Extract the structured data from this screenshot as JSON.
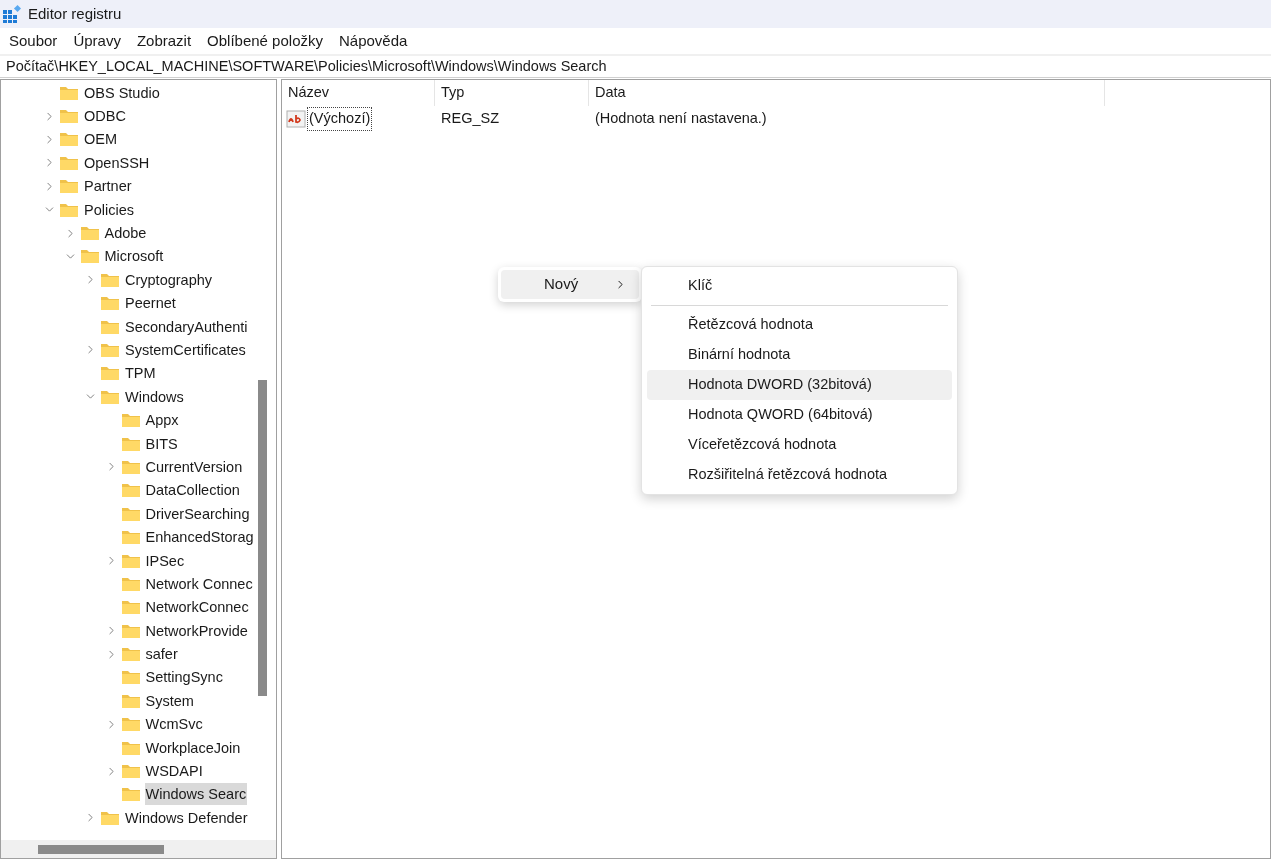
{
  "window": {
    "title": "Editor registru"
  },
  "menu": [
    "Soubor",
    "Úpravy",
    "Zobrazit",
    "Oblíbené položky",
    "Nápověda"
  ],
  "address": "Počítač\\HKEY_LOCAL_MACHINE\\SOFTWARE\\Policies\\Microsoft\\Windows\\Windows Search",
  "tree": [
    {
      "name": "OBS Studio",
      "selected": false
    },
    {
      "name": "ODBC",
      "expanded": false,
      "selected": false
    },
    {
      "name": "OEM",
      "expanded": false,
      "selected": false
    },
    {
      "name": "OpenSSH",
      "expanded": false,
      "selected": false
    },
    {
      "name": "Partner",
      "expanded": false,
      "selected": false
    },
    {
      "name": "Policies",
      "expanded": true,
      "selected": false,
      "children": [
        {
          "name": "Adobe",
          "expanded": false,
          "selected": false
        },
        {
          "name": "Microsoft",
          "expanded": true,
          "selected": false,
          "children": [
            {
              "name": "Cryptography",
              "expanded": false,
              "selected": false
            },
            {
              "name": "Peernet",
              "selected": false
            },
            {
              "name": "SecondaryAuthenti",
              "selected": false
            },
            {
              "name": "SystemCertificates",
              "expanded": false,
              "selected": false
            },
            {
              "name": "TPM",
              "selected": false
            },
            {
              "name": "Windows",
              "expanded": true,
              "selected": false,
              "children": [
                {
                  "name": "Appx",
                  "selected": false
                },
                {
                  "name": "BITS",
                  "selected": false
                },
                {
                  "name": "CurrentVersion",
                  "expanded": false,
                  "selected": false
                },
                {
                  "name": "DataCollection",
                  "selected": false
                },
                {
                  "name": "DriverSearching",
                  "selected": false
                },
                {
                  "name": "EnhancedStorag",
                  "selected": false
                },
                {
                  "name": "IPSec",
                  "expanded": false,
                  "selected": false
                },
                {
                  "name": "Network Connec",
                  "selected": false
                },
                {
                  "name": "NetworkConnec",
                  "selected": false
                },
                {
                  "name": "NetworkProvide",
                  "expanded": false,
                  "selected": false
                },
                {
                  "name": "safer",
                  "expanded": false,
                  "selected": false
                },
                {
                  "name": "SettingSync",
                  "selected": false
                },
                {
                  "name": "System",
                  "selected": false
                },
                {
                  "name": "WcmSvc",
                  "expanded": false,
                  "selected": false
                },
                {
                  "name": "WorkplaceJoin",
                  "selected": false
                },
                {
                  "name": "WSDAPI",
                  "expanded": false,
                  "selected": false
                },
                {
                  "name": "Windows Searc",
                  "selected": true
                }
              ]
            },
            {
              "name": "Windows Defender",
              "expanded": false,
              "selected": false
            }
          ]
        }
      ]
    }
  ],
  "table": {
    "columns": [
      "Název",
      "Typ",
      "Data"
    ],
    "rows": [
      {
        "name": "(Výchozí)",
        "type": "REG_SZ",
        "data": "(Hodnota není nastavena.)"
      }
    ]
  },
  "context_menu": {
    "item": {
      "label": "Nový",
      "selected": true
    },
    "submenu": [
      {
        "label": "Klíč",
        "selected": false
      },
      {
        "kind": "separator"
      },
      {
        "label": "Řetězcová hodnota",
        "selected": false
      },
      {
        "label": "Binární hodnota",
        "selected": false
      },
      {
        "label": "Hodnota DWORD (32bitová)",
        "selected": true
      },
      {
        "label": "Hodnota QWORD (64bitová)",
        "selected": false
      },
      {
        "label": "Víceřetězcová hodnota",
        "selected": false
      },
      {
        "label": "Rozšiřitelná řetězcová hodnota",
        "selected": false
      }
    ]
  }
}
